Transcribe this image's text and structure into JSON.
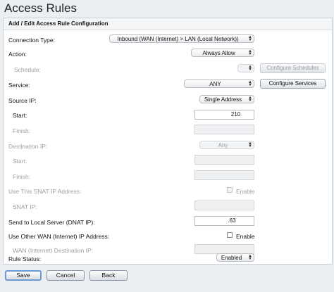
{
  "page": {
    "title": "Access Rules"
  },
  "panel": {
    "heading": "Add / Edit Access Rule Configuration"
  },
  "form": {
    "connection_type": {
      "label": "Connection Type:",
      "value": "Inbound (WAN (Internet) > LAN (Local Network))"
    },
    "action": {
      "label": "Action:",
      "value": "Always Allow"
    },
    "schedule": {
      "label": "Schedule:",
      "value": "",
      "button": "Configure Schedules"
    },
    "service": {
      "label": "Service:",
      "value": "ANY",
      "button": "Configure Services"
    },
    "source_ip": {
      "label": "Source IP:",
      "value": "Single Address"
    },
    "source_start": {
      "label": "Start:",
      "value_visible": "210"
    },
    "source_finish": {
      "label": "Finish:",
      "value": ""
    },
    "destination_ip": {
      "label": "Destination IP:",
      "value": "Any"
    },
    "dest_start": {
      "label": "Start:",
      "value": ""
    },
    "dest_finish": {
      "label": "Finish:",
      "value": ""
    },
    "use_snat": {
      "label": "Use This SNAT IP Address:",
      "checkbox_label": "Enable"
    },
    "snat_ip": {
      "label": "SNAT IP:",
      "value": ""
    },
    "send_local": {
      "label": "Send to Local Server (DNAT IP):",
      "value_visible": ".63"
    },
    "other_wan": {
      "label": "Use Other WAN (Internet) IP Address:",
      "checkbox_label": "Enable"
    },
    "wan_dest": {
      "label": "WAN (Internet) Destination IP:",
      "value": ""
    },
    "rule_status": {
      "label": "Rule Status:",
      "value": "Enabled"
    }
  },
  "footer": {
    "save": "Save",
    "cancel": "Cancel",
    "back": "Back"
  }
}
